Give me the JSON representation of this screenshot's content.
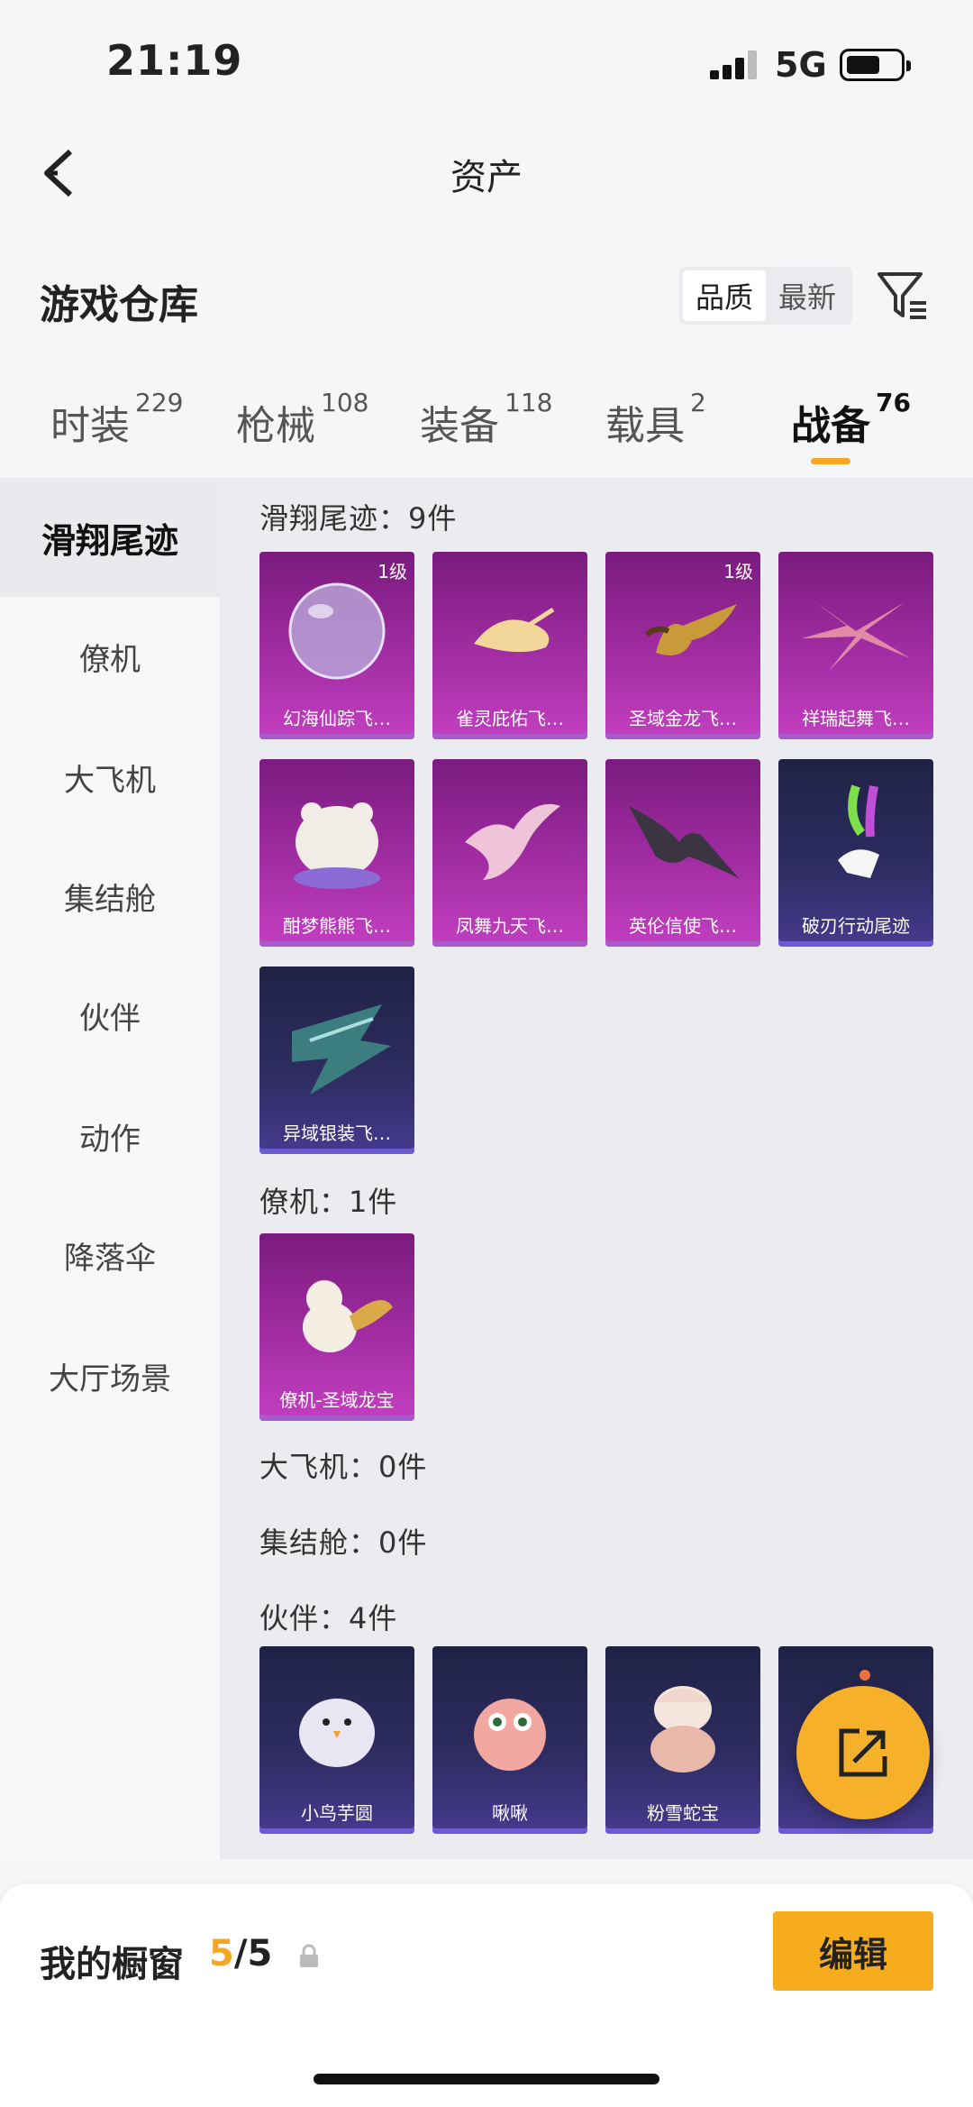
{
  "status_bar": {
    "time": "21:19",
    "network": "5G"
  },
  "nav": {
    "title": "资产"
  },
  "warehouse": {
    "title": "游戏仓库",
    "sort_options": [
      "品质",
      "最新"
    ],
    "active_sort": "品质"
  },
  "tabs": [
    {
      "label": "时装",
      "count": "229"
    },
    {
      "label": "枪械",
      "count": "108"
    },
    {
      "label": "装备",
      "count": "118"
    },
    {
      "label": "载具",
      "count": "2"
    },
    {
      "label": "战备",
      "count": "76",
      "active": true
    }
  ],
  "sidebar": {
    "items": [
      {
        "label": "滑翔尾迹",
        "active": true
      },
      {
        "label": "僚机"
      },
      {
        "label": "大飞机"
      },
      {
        "label": "集结舱"
      },
      {
        "label": "伙伴"
      },
      {
        "label": "动作"
      },
      {
        "label": "降落伞"
      },
      {
        "label": "大厅场景"
      }
    ]
  },
  "sections": {
    "glide": {
      "title": "滑翔尾迹：9件",
      "items": [
        {
          "name": "幻海仙踪飞…",
          "level": "1级",
          "color": "purple"
        },
        {
          "name": "雀灵庇佑飞…",
          "color": "purple"
        },
        {
          "name": "圣域金龙飞…",
          "level": "1级",
          "color": "purple"
        },
        {
          "name": "祥瑞起舞飞…",
          "color": "purple"
        },
        {
          "name": "酣梦熊熊飞…",
          "color": "purple"
        },
        {
          "name": "凤舞九天飞…",
          "color": "purple"
        },
        {
          "name": "英伦信使飞…",
          "color": "purple"
        },
        {
          "name": "破刃行动尾迹",
          "color": "navy"
        },
        {
          "name": "异域银装飞…",
          "color": "navy"
        }
      ]
    },
    "wingman": {
      "title": "僚机：1件",
      "items": [
        {
          "name": "僚机-圣域龙宝",
          "color": "purple"
        }
      ]
    },
    "big_plane": {
      "title": "大飞机：0件"
    },
    "capsule": {
      "title": "集结舱：0件"
    },
    "partner": {
      "title": "伙伴：4件",
      "items": [
        {
          "name": "小鸟芋圆",
          "color": "navy"
        },
        {
          "name": "啾啾",
          "color": "navy"
        },
        {
          "name": "粉雪蛇宝",
          "color": "navy"
        },
        {
          "name": "",
          "color": "navy"
        }
      ]
    }
  },
  "bottom": {
    "showcase_label": "我的橱窗",
    "showcase_current": "5",
    "showcase_total": "/5",
    "edit_label": "编辑"
  },
  "colors": {
    "accent": "#f5a623",
    "card_purple": "#a22da3",
    "card_navy": "#2f2d63"
  }
}
